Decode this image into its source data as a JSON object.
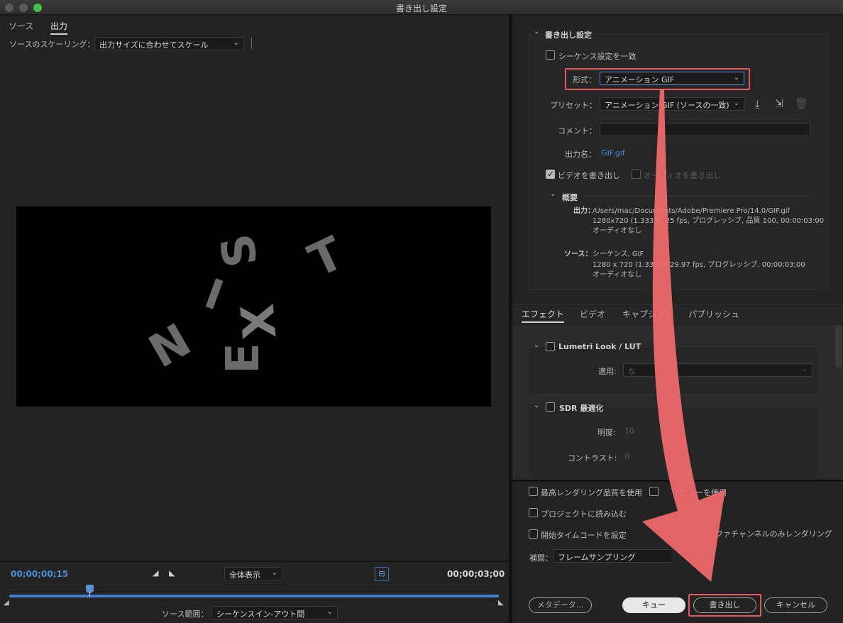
{
  "window": {
    "title": "書き出し設定"
  },
  "left": {
    "tabs": [
      "ソース",
      "出力"
    ],
    "scaling_label": "ソースのスケーリング：",
    "scaling_value": "出力サイズに合わせてスケール",
    "timecode_current": "00;00;00;15",
    "timecode_end": "00;00;03;00",
    "zoom_value": "全体表示",
    "source_range_label": "ソース範囲：",
    "source_range_value": "シーケンスイン-アウト間",
    "preview_letters": [
      "S",
      "T",
      "I",
      "N",
      "X",
      "E"
    ]
  },
  "export": {
    "section_title": "書き出し設定",
    "match_sequence": "シーケンス設定を一致",
    "format_label": "形式：",
    "format_value": "アニメーション GIF",
    "preset_label": "プリセット：",
    "preset_value": "アニメーション GIF (ソースの一致)",
    "comment_label": "コメント：",
    "comment_value": "",
    "output_name_label": "出力名：",
    "output_name_value": "GIF.gif",
    "export_video": "ビデオを書き出し",
    "export_audio": "オーディオを書き出し",
    "summary_title": "概要",
    "summary_output_label": "出力：",
    "summary_output_lines": [
      "/Users/mac/Documents/Adobe/Premiere Pro/14.0/GIF.gif",
      "1280x720 (1.3333), 25 fps, プログレッシブ, 品質 100, 00:00:03:00",
      "オーディオなし"
    ],
    "summary_source_label": "ソース：",
    "summary_source_lines": [
      "シーケンス, GIF",
      "1280 x 720 (1.3333), 29.97 fps, プログレッシブ, 00;00;03;00",
      "オーディオなし"
    ]
  },
  "tabs2": [
    "エフェクト",
    "ビデオ",
    "キャプション",
    "パブリッシュ"
  ],
  "effects": {
    "lumetri_title": "Lumetri Look / LUT",
    "apply_label": "適用:",
    "apply_value": "な",
    "sdr_title": "SDR 最適化",
    "brightness_label": "明度:",
    "brightness_value": "10",
    "contrast_label": "コントラスト:",
    "contrast_value": "0"
  },
  "bottom": {
    "max_quality": "最高レンダリング品質を使用",
    "preview_use": "ビューを使用",
    "import_project": "プロジェクトに読み込む",
    "start_timecode": "開始タイムコードを設定",
    "alpha_only": "ファチャンネルのみレンダリング",
    "interp_label": "補間：",
    "interp_value": "フレームサンプリング",
    "btn_metadata": "メタデータ...",
    "btn_queue": "キュー",
    "btn_export": "書き出し",
    "btn_cancel": "キャンセル"
  },
  "colors": {
    "highlight": "#e25a5f",
    "arrow": "#f26a6d",
    "timecode": "#4b8fd8",
    "link": "#4b8fd8"
  }
}
